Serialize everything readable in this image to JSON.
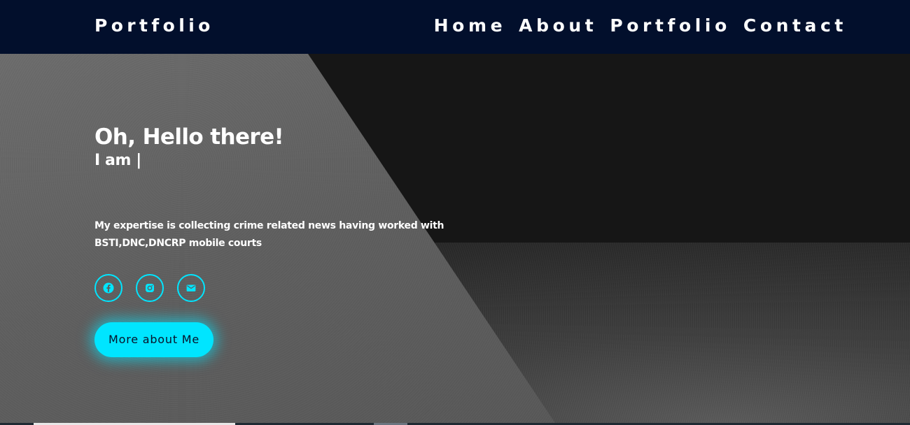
{
  "navbar": {
    "brand": "Portfolio",
    "links": [
      {
        "label": "Home"
      },
      {
        "label": "About"
      },
      {
        "label": "Portfolio"
      },
      {
        "label": "Contact"
      }
    ]
  },
  "hero": {
    "greeting": "Oh, Hello there!",
    "typed_text": "I am |",
    "bio": "My expertise is collecting crime related news having worked with BSTI,DNC,DNCRP mobile courts",
    "socials": [
      {
        "icon": "facebook-icon"
      },
      {
        "icon": "instagram-icon"
      },
      {
        "icon": "mail-icon"
      }
    ],
    "cta_label": "More about Me"
  },
  "colors": {
    "navbar_bg": "#020f2c",
    "accent": "#00e5ff",
    "text": "#ffffff"
  }
}
